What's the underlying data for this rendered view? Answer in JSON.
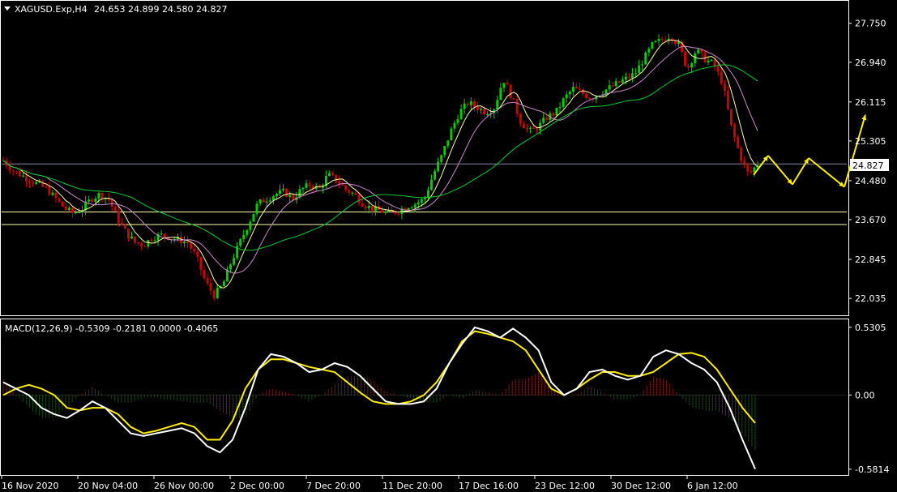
{
  "header": {
    "symbol": "XAGUSD.Exp,H4",
    "ohlc": "24.653 24.899 24.580 24.827",
    "dropdown_icon": "triangle-down-icon"
  },
  "macd_header": "MACD(12,26,9) -0.5309 -0.2181 0.0000 -0.4065",
  "current_price": "24.827",
  "colors": {
    "background": "#000000",
    "bull": "#00cc00",
    "bear": "#cc0000",
    "ma_fast": "#ffffaa",
    "ma_mid": "#cc88cc",
    "ma_slow": "#00cc33",
    "macd_line": "#ffffff",
    "signal_line": "#ffee00",
    "hist_pos": "#cc3333",
    "hist_neg": "#338833",
    "arrows": "#ffee00",
    "levels": "#ffffaa",
    "grid_frame": "#ffffff"
  },
  "chart_data": [
    {
      "type": "line",
      "name_label": "XAGUSD.Exp,H4",
      "y_ticks": [
        "27.750",
        "26.940",
        "26.115",
        "25.305",
        "24.480",
        "23.670",
        "22.845",
        "22.035"
      ],
      "y_tick_values": [
        27.75,
        26.94,
        26.115,
        25.305,
        24.48,
        23.67,
        22.845,
        22.035
      ],
      "ylim": [
        21.7,
        28.2
      ],
      "x_ticks": [
        "16 Nov 2020",
        "20 Nov 04:00",
        "26 Nov 00:00",
        "2 Dec 00:00",
        "7 Dec 20:00",
        "11 Dec 20:00",
        "17 Dec 16:00",
        "23 Dec 12:00",
        "30 Dec 12:00",
        "6 Jan 12:00"
      ],
      "levels": [
        24.827,
        23.83,
        23.57
      ],
      "price_path": [
        24.9,
        24.7,
        24.6,
        24.5,
        24.4,
        24.3,
        24.1,
        23.9,
        23.8,
        23.9,
        24.1,
        24.2,
        24.1,
        23.7,
        23.4,
        23.2,
        23.15,
        23.3,
        23.35,
        23.3,
        23.25,
        23.2,
        22.9,
        22.4,
        22.1,
        22.3,
        22.8,
        23.2,
        23.6,
        24.0,
        24.1,
        24.2,
        24.25,
        24.1,
        24.3,
        24.4,
        24.3,
        24.6,
        24.5,
        24.3,
        24.2,
        24.0,
        23.9,
        23.85,
        23.8,
        23.85,
        23.95,
        24.0,
        24.1,
        24.6,
        25.0,
        25.5,
        25.9,
        26.1,
        26.0,
        25.9,
        26.0,
        26.6,
        26.2,
        25.7,
        25.5,
        25.6,
        25.8,
        25.9,
        26.2,
        26.4,
        26.3,
        26.2,
        26.3,
        26.4,
        26.5,
        26.6,
        26.7,
        27.0,
        27.3,
        27.4,
        27.5,
        27.3,
        26.8,
        27.2,
        27.0,
        26.9,
        26.5,
        25.6,
        25.0,
        24.6,
        24.83
      ],
      "projection_arrows": [
        [
          24.6,
          25.0
        ],
        [
          25.0,
          24.4
        ],
        [
          24.4,
          24.95
        ],
        [
          24.95,
          24.35
        ],
        [
          24.35,
          25.85
        ]
      ]
    },
    {
      "type": "area",
      "indicator": "MACD(12,26,9)",
      "y_ticks": [
        "0.5305",
        "0.00",
        "-0.5814"
      ],
      "y_tick_values": [
        0.5305,
        0.0,
        -0.5814
      ],
      "ylim": [
        -0.62,
        0.58
      ],
      "macd": [
        0.1,
        0.05,
        0.0,
        -0.1,
        -0.15,
        -0.18,
        -0.12,
        -0.05,
        -0.1,
        -0.2,
        -0.3,
        -0.32,
        -0.3,
        -0.28,
        -0.26,
        -0.3,
        -0.4,
        -0.45,
        -0.35,
        -0.1,
        0.2,
        0.32,
        0.3,
        0.25,
        0.18,
        0.2,
        0.25,
        0.22,
        0.15,
        0.05,
        -0.05,
        -0.07,
        -0.07,
        -0.05,
        0.05,
        0.25,
        0.4,
        0.53,
        0.5,
        0.45,
        0.52,
        0.45,
        0.35,
        0.1,
        0.0,
        0.05,
        0.18,
        0.2,
        0.15,
        0.12,
        0.15,
        0.3,
        0.35,
        0.32,
        0.25,
        0.2,
        0.1,
        -0.1,
        -0.35,
        -0.58
      ],
      "signal": [
        0.0,
        0.05,
        0.08,
        0.05,
        0.0,
        -0.1,
        -0.12,
        -0.1,
        -0.1,
        -0.15,
        -0.25,
        -0.3,
        -0.28,
        -0.25,
        -0.22,
        -0.25,
        -0.35,
        -0.35,
        -0.2,
        0.05,
        0.2,
        0.28,
        0.28,
        0.25,
        0.22,
        0.2,
        0.18,
        0.1,
        0.02,
        -0.05,
        -0.07,
        -0.07,
        -0.05,
        0.0,
        0.1,
        0.25,
        0.42,
        0.5,
        0.48,
        0.45,
        0.42,
        0.35,
        0.2,
        0.05,
        0.0,
        0.05,
        0.12,
        0.18,
        0.18,
        0.15,
        0.15,
        0.18,
        0.25,
        0.32,
        0.33,
        0.3,
        0.2,
        0.05,
        -0.1,
        -0.22
      ]
    }
  ]
}
